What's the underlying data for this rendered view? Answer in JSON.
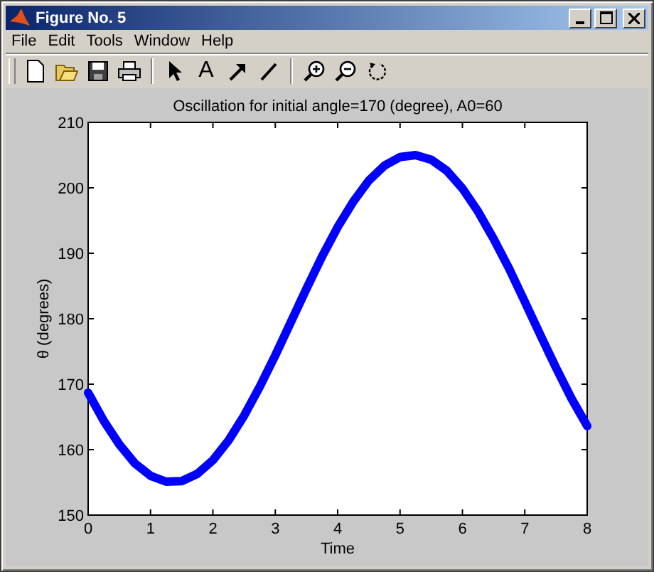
{
  "window": {
    "title": "Figure No. 5"
  },
  "menu": [
    "File",
    "Edit",
    "Tools",
    "Window",
    "Help"
  ],
  "toolbar": [
    {
      "kind": "new"
    },
    {
      "kind": "open"
    },
    {
      "kind": "save"
    },
    {
      "kind": "print"
    },
    {
      "kind": "sep"
    },
    {
      "kind": "pointer"
    },
    {
      "kind": "text",
      "label": "A"
    },
    {
      "kind": "arrow"
    },
    {
      "kind": "line"
    },
    {
      "kind": "sep"
    },
    {
      "kind": "zoomin"
    },
    {
      "kind": "zoomout"
    },
    {
      "kind": "rotate"
    }
  ],
  "figure": {
    "chart_data": {
      "type": "line",
      "title": "Oscillation for initial angle=170 (degree), A0=60",
      "xlabel": "Time",
      "ylabel": "θ (degrees)",
      "x": [
        0,
        0.25,
        0.5,
        0.75,
        1,
        1.25,
        1.5,
        1.75,
        2,
        2.25,
        2.5,
        2.75,
        3,
        3.25,
        3.5,
        3.75,
        4,
        4.25,
        4.5,
        4.75,
        5,
        5.25,
        5.5,
        5.75,
        6,
        6.25,
        6.5,
        6.75,
        7,
        7.25,
        7.5,
        7.75,
        8
      ],
      "series": [
        {
          "color": "#0000ff",
          "values": [
            168.7,
            164.4,
            160.8,
            157.9,
            156.0,
            155.1,
            155.2,
            156.3,
            158.4,
            161.4,
            165.2,
            169.6,
            174.4,
            179.5,
            184.6,
            189.5,
            194.0,
            197.9,
            201.1,
            203.4,
            204.7,
            205.0,
            204.3,
            202.6,
            199.9,
            196.4,
            192.2,
            187.6,
            182.6,
            177.5,
            172.5,
            167.8,
            163.6
          ]
        }
      ],
      "xlim": [
        0,
        8
      ],
      "ylim": [
        150,
        210
      ],
      "xticks": [
        0,
        1,
        2,
        3,
        4,
        5,
        6,
        7,
        8
      ],
      "yticks": [
        150,
        160,
        170,
        180,
        190,
        200,
        210
      ]
    }
  }
}
